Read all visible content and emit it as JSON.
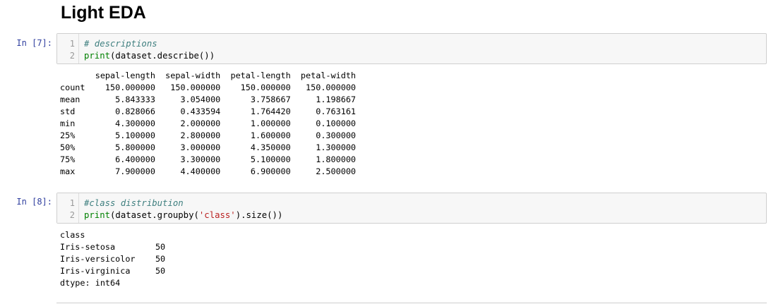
{
  "notebook": {
    "heading": "Light EDA",
    "cells": [
      {
        "prompt": "In [7]:",
        "lines": [
          {
            "number": "1",
            "comment": "# descriptions"
          },
          {
            "number": "2",
            "builtin": "print",
            "code": "(dataset.describe())"
          }
        ],
        "output": "       sepal-length  sepal-width  petal-length  petal-width\ncount    150.000000   150.000000    150.000000   150.000000\nmean       5.843333     3.054000      3.758667     1.198667\nstd        0.828066     0.433594      1.764420     0.763161\nmin        4.300000     2.000000      1.000000     0.100000\n25%        5.100000     2.800000      1.600000     0.300000\n50%        5.800000     3.000000      4.350000     1.300000\n75%        6.400000     3.300000      5.100000     1.800000\nmax        7.900000     4.400000      6.900000     2.500000"
      },
      {
        "prompt": "In [8]:",
        "lines": [
          {
            "number": "1",
            "comment": "#class distribution"
          },
          {
            "number": "2",
            "builtin": "print",
            "code_before": "(dataset.groupby(",
            "string": "'class'",
            "code_after": ").size())"
          }
        ],
        "output": "class\nIris-setosa        50\nIris-versicolor    50\nIris-virginica     50\ndtype: int64"
      }
    ]
  }
}
